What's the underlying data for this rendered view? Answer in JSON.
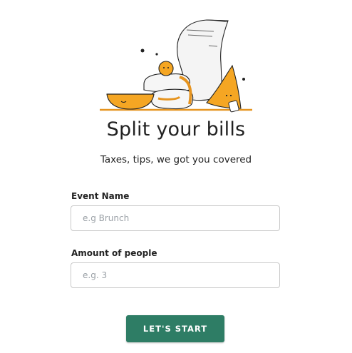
{
  "colors": {
    "accent": "#f5a623",
    "primary_button": "#2e7d65"
  },
  "hero": {
    "illustration_icon": "bill-receipt-food-illustration",
    "title": "Split your bills",
    "subtitle": "Taxes, tips, we got you covered"
  },
  "form": {
    "event_name_label": "Event Name",
    "event_name_value": "",
    "event_name_placeholder": "e.g Brunch",
    "people_label": "Amount of people",
    "people_value": "",
    "people_placeholder": "e.g. 3",
    "start_label": "LET'S START"
  }
}
